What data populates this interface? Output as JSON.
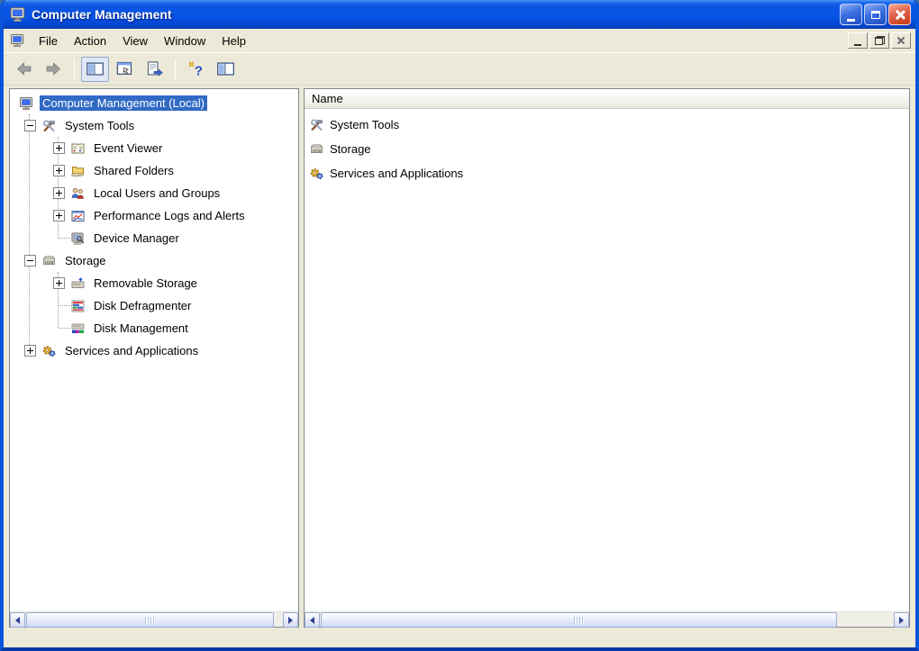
{
  "window": {
    "title": "Computer Management"
  },
  "menubar": {
    "items": [
      "File",
      "Action",
      "View",
      "Window",
      "Help"
    ]
  },
  "toolbar": {
    "buttons": [
      "back",
      "forward",
      "show-hide-console-tree",
      "properties",
      "export-list",
      "help",
      "show-hide-action-pane"
    ]
  },
  "tree": {
    "items": [
      {
        "label": "Computer Management (Local)",
        "icon": "computer-icon",
        "level": 0,
        "expand": "none",
        "selected": true
      },
      {
        "label": "System Tools",
        "icon": "system-tools-icon",
        "level": 1,
        "expand": "minus",
        "selected": false
      },
      {
        "label": "Event Viewer",
        "icon": "event-viewer-icon",
        "level": 2,
        "expand": "plus",
        "selected": false
      },
      {
        "label": "Shared Folders",
        "icon": "shared-folders-icon",
        "level": 2,
        "expand": "plus",
        "selected": false
      },
      {
        "label": "Local Users and Groups",
        "icon": "users-icon",
        "level": 2,
        "expand": "plus",
        "selected": false
      },
      {
        "label": "Performance Logs and Alerts",
        "icon": "performance-icon",
        "level": 2,
        "expand": "plus",
        "selected": false
      },
      {
        "label": "Device Manager",
        "icon": "device-manager-icon",
        "level": 2,
        "expand": "none",
        "selected": false
      },
      {
        "label": "Storage",
        "icon": "storage-icon",
        "level": 1,
        "expand": "minus",
        "selected": false
      },
      {
        "label": "Removable Storage",
        "icon": "removable-storage-icon",
        "level": 2,
        "expand": "plus",
        "selected": false
      },
      {
        "label": "Disk Defragmenter",
        "icon": "disk-defragmenter-icon",
        "level": 2,
        "expand": "none",
        "selected": false
      },
      {
        "label": "Disk Management",
        "icon": "disk-management-icon",
        "level": 2,
        "expand": "none",
        "selected": false
      },
      {
        "label": "Services and Applications",
        "icon": "services-icon",
        "level": 1,
        "expand": "plus",
        "selected": false
      }
    ]
  },
  "list": {
    "columns": [
      "Name"
    ],
    "items": [
      {
        "label": "System Tools",
        "icon": "system-tools-icon"
      },
      {
        "label": "Storage",
        "icon": "storage-icon"
      },
      {
        "label": "Services and Applications",
        "icon": "services-icon"
      }
    ]
  },
  "colors": {
    "titlebar_top": "#4a96f4",
    "titlebar_bottom": "#0a3fb0",
    "window_border": "#0855dd",
    "chrome": "#ece9d8",
    "selection": "#316ac5",
    "pane_background": "#ffffff"
  }
}
